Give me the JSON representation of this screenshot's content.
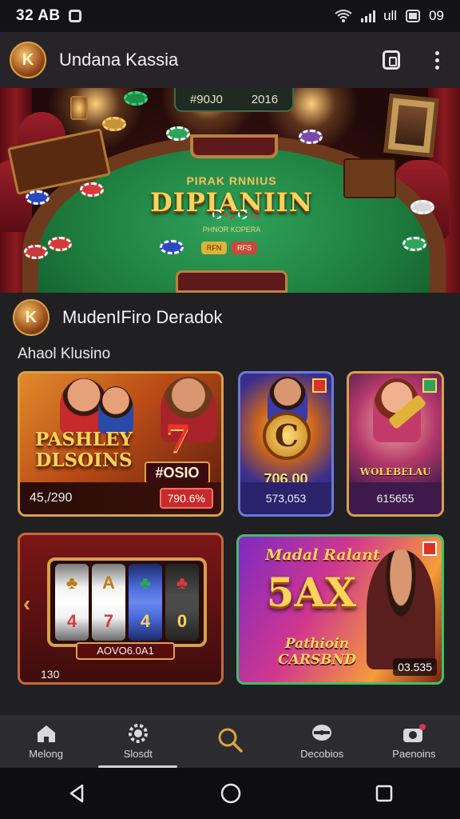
{
  "status_bar": {
    "time": "32 AB",
    "right_text": "ull",
    "battery_label": "09"
  },
  "app_bar": {
    "avatar_text": "K",
    "title": "Undana Kassia"
  },
  "banner": {
    "sign_left": "#90J0",
    "sign_right": "2016",
    "table_subtitle": "PIRAK RNNIUS",
    "table_title": "DIPIANIIN",
    "table_caption": "PHNOR KOPERA",
    "bet_labels": [
      "RFN",
      "RFS"
    ]
  },
  "section": {
    "avatar_text": "K",
    "name": "MudenIFiro Deradok",
    "subtitle": "Ahaol Klusino"
  },
  "cards": [
    {
      "title": "PASHLEY DLSOINS",
      "badge": "#OSIO",
      "left_value": "45,/290",
      "right_value": "790.6%"
    },
    {
      "title": "C",
      "big_value": "706.00",
      "value": "573,053"
    },
    {
      "title": "WOLEBELAU",
      "value": "615655"
    },
    {
      "reel_symbols": [
        "4",
        "A",
        "4",
        "0"
      ],
      "reel_label": "AOVO6.0A1",
      "value": "130"
    },
    {
      "header": "Madal Ralant",
      "big_text": "5AX",
      "caption": "Pathioin CARSBND",
      "value": "03.535"
    }
  ],
  "bottom_nav": [
    {
      "label": "Melong",
      "icon": "home-icon"
    },
    {
      "label": "Slosdt",
      "icon": "chip-icon"
    },
    {
      "label": "",
      "icon": "search-icon"
    },
    {
      "label": "Decobios",
      "icon": "dice-icon"
    },
    {
      "label": "Paenoins",
      "icon": "camera-icon"
    }
  ],
  "colors": {
    "accent": "#d8a049",
    "felt": "#1d7a3c",
    "panel": "#201f22",
    "search": "#e0a244"
  }
}
